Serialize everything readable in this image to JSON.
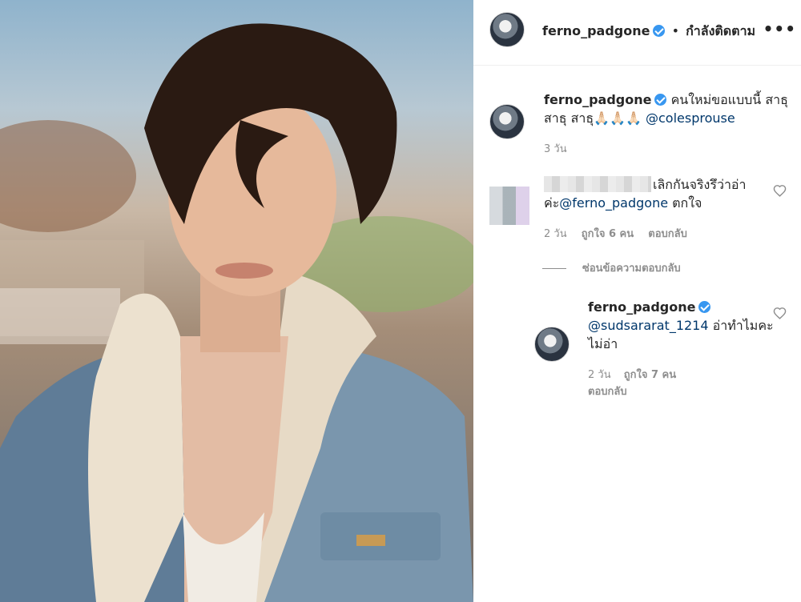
{
  "post": {
    "username": "ferno_padgone",
    "follow_status": "กำลังติดตาม",
    "separator": "•",
    "more_label": "•••"
  },
  "caption": {
    "username": "ferno_padgone",
    "text": "คนใหม่ขอแบบนี้ สาธุ สาธุ สาธุ🙏🏻🙏🏻🙏🏻",
    "mention": "@colesprouse",
    "time": "3 วัน"
  },
  "comments": [
    {
      "text": "เลิกกันจริงรึว่าอ่าค่ะ",
      "mention": "@ferno_padgone",
      "text_after": "ตกใจ",
      "time": "2 วัน",
      "likes": "ถูกใจ 6 คน",
      "reply_label": "ตอบกลับ",
      "hide_replies": "ซ่อนข้อความตอบกลับ",
      "replies": [
        {
          "username": "ferno_padgone",
          "mention": "@sudsararat_1214",
          "text": "อ่าทำไมคะ ไม่อ่า",
          "time": "2 วัน",
          "likes": "ถูกใจ 7 คน",
          "reply_label": "ตอบกลับ"
        }
      ]
    }
  ],
  "colors": {
    "verified": "#3897f0",
    "mention": "#00376b",
    "meta": "#8e8e8e"
  },
  "icons": [
    "verified-badge-icon",
    "heart-icon",
    "more-options-icon"
  ]
}
